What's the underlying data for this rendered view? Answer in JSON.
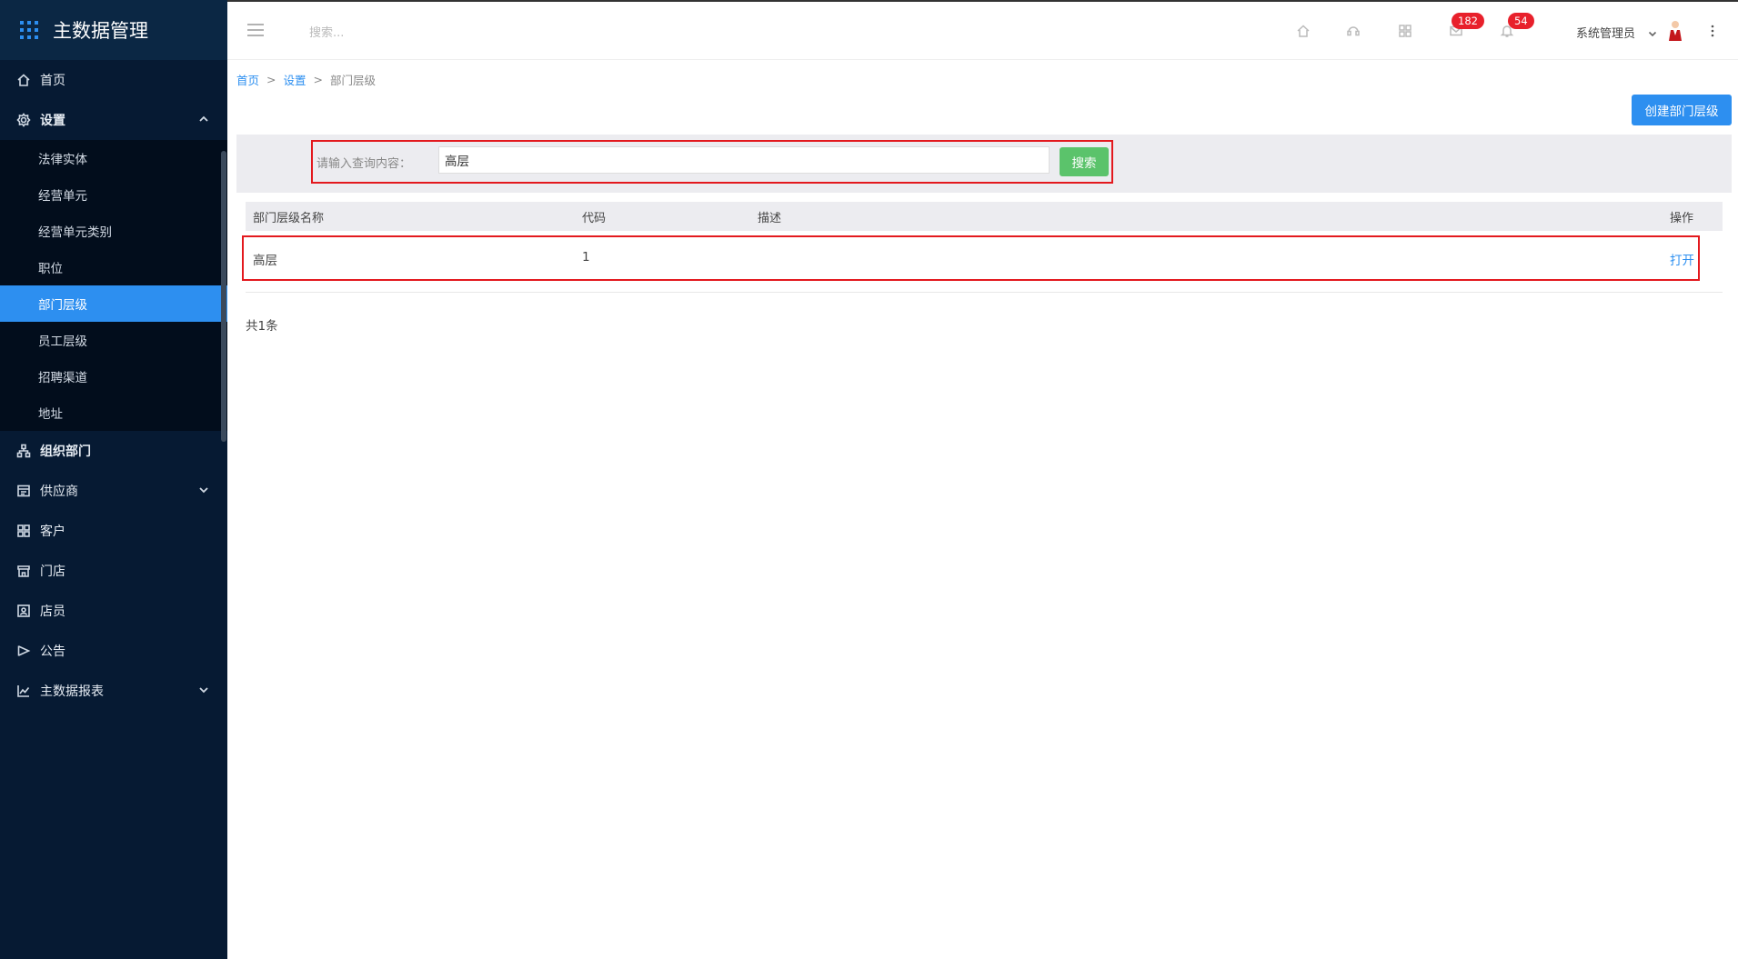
{
  "app": {
    "title": "主数据管理"
  },
  "sidebar": {
    "items": [
      {
        "label": "首页",
        "icon": "home-icon"
      },
      {
        "label": "设置",
        "icon": "gear-icon",
        "expanded": true
      },
      {
        "label": "组织部门",
        "icon": "org-tree-icon"
      },
      {
        "label": "供应商",
        "icon": "supplier-icon"
      },
      {
        "label": "客户",
        "icon": "customer-icon"
      },
      {
        "label": "门店",
        "icon": "store-icon"
      },
      {
        "label": "店员",
        "icon": "clerk-icon"
      },
      {
        "label": "公告",
        "icon": "announcement-icon"
      },
      {
        "label": "主数据报表",
        "icon": "chart-line-icon"
      }
    ],
    "settings_sub": [
      "法律实体",
      "经营单元",
      "经营单元类别",
      "职位",
      "部门层级",
      "员工层级",
      "招聘渠道",
      "地址"
    ],
    "active_sub": "部门层级"
  },
  "header": {
    "search_placeholder": "搜索...",
    "badges": {
      "mail": "182",
      "bell": "54"
    },
    "user": "系统管理员"
  },
  "breadcrumb": {
    "home": "首页",
    "settings": "设置",
    "current": "部门层级",
    "sep": ">"
  },
  "toolbar": {
    "create_label": "创建部门层级"
  },
  "search": {
    "label": "请输入查询内容：",
    "value": "高层",
    "button": "搜索"
  },
  "table": {
    "columns": [
      "部门层级名称",
      "代码",
      "描述",
      "操作"
    ],
    "rows": [
      {
        "name": "高层",
        "code": "1",
        "desc": "",
        "action": "打开"
      }
    ]
  },
  "footer": {
    "total": "共1条"
  },
  "colors": {
    "sidebar_bg": "#061a33",
    "accent": "#2d8ff0",
    "search_btn": "#5bc36b",
    "badge": "#e8202b",
    "highlight": "#e3191e"
  }
}
